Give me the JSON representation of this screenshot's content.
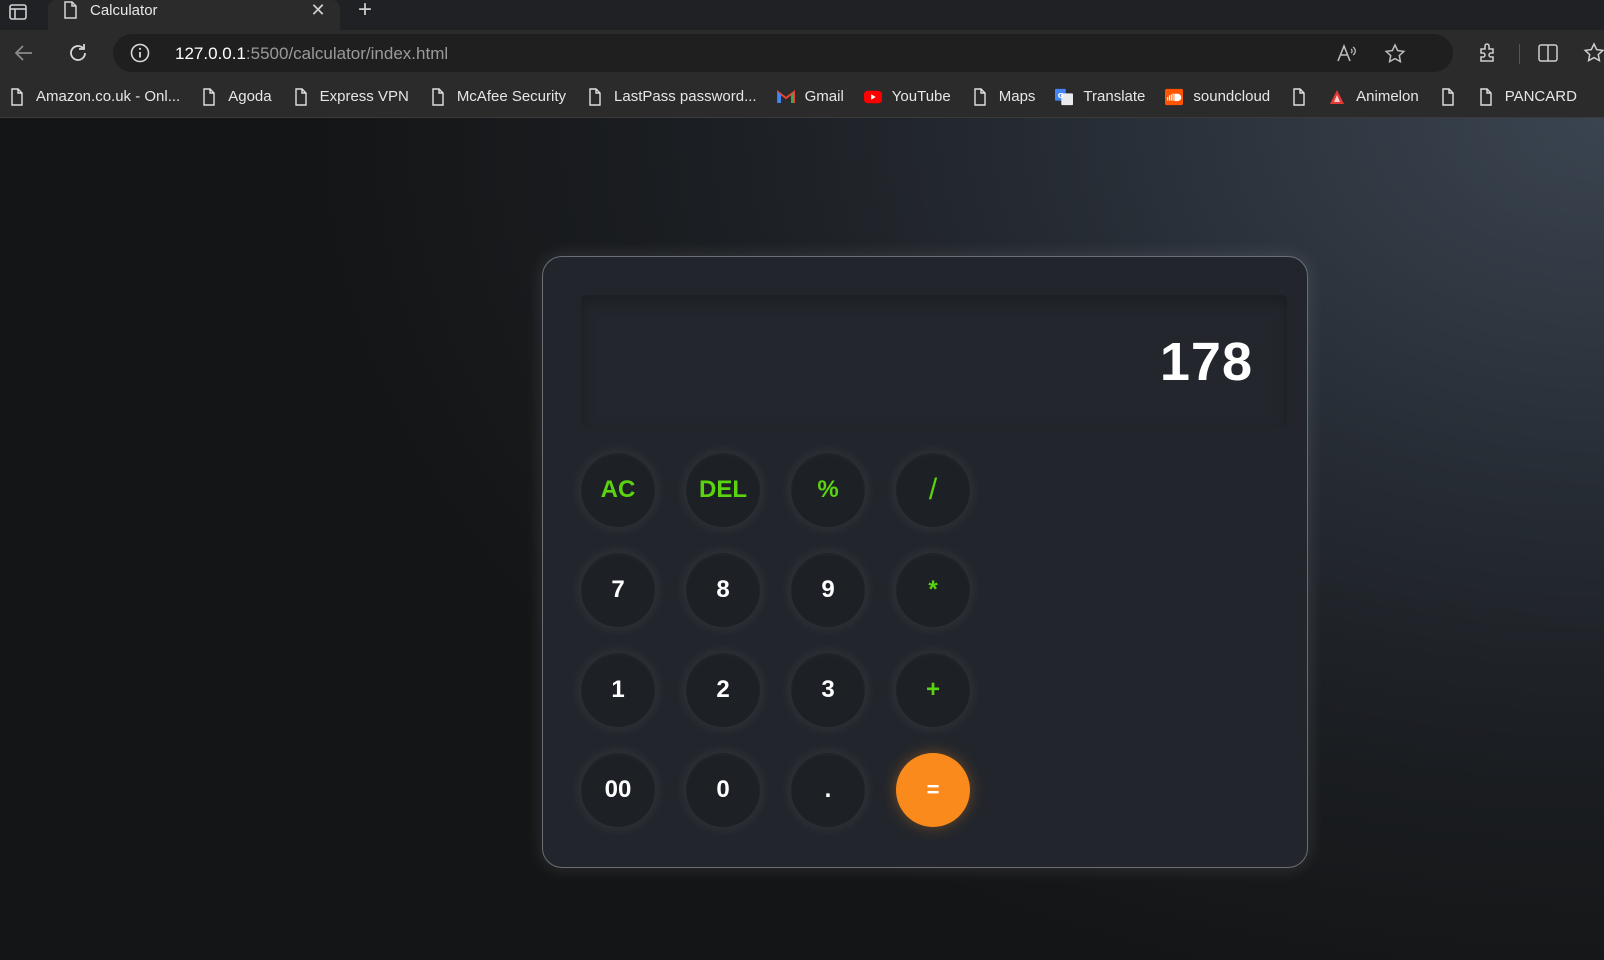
{
  "browser": {
    "tab_title": "Calculator",
    "url_host": "127.0.0.1",
    "url_path": ":5500/calculator/index.html"
  },
  "bookmarks": [
    {
      "label": "Amazon.co.uk - Onl...",
      "icon": "page-icon"
    },
    {
      "label": "Agoda",
      "icon": "page-icon"
    },
    {
      "label": "Express VPN",
      "icon": "page-icon"
    },
    {
      "label": "McAfee Security",
      "icon": "page-icon"
    },
    {
      "label": "LastPass password...",
      "icon": "page-icon"
    },
    {
      "label": "Gmail",
      "icon": "gmail-icon"
    },
    {
      "label": "YouTube",
      "icon": "youtube-icon"
    },
    {
      "label": "Maps",
      "icon": "page-icon"
    },
    {
      "label": "Translate",
      "icon": "translate-icon"
    },
    {
      "label": "soundcloud",
      "icon": "soundcloud-icon"
    },
    {
      "label": "",
      "icon": "page-icon"
    },
    {
      "label": "Animelon",
      "icon": "animelon-icon"
    },
    {
      "label": "",
      "icon": "page-icon"
    },
    {
      "label": "PANCARD",
      "icon": "page-icon"
    }
  ],
  "calculator": {
    "display": "178",
    "keys": {
      "ac": "AC",
      "del": "DEL",
      "percent": "%",
      "divide": "/",
      "seven": "7",
      "eight": "8",
      "nine": "9",
      "multiply": "*",
      "one": "1",
      "two": "2",
      "three": "3",
      "plus": "+",
      "double_zero": "00",
      "zero": "0",
      "dot": ".",
      "equals": "="
    }
  },
  "colors": {
    "operator": "#59d40f",
    "equals_bg": "#fb8a1c",
    "key_bg": "#1d2025"
  }
}
